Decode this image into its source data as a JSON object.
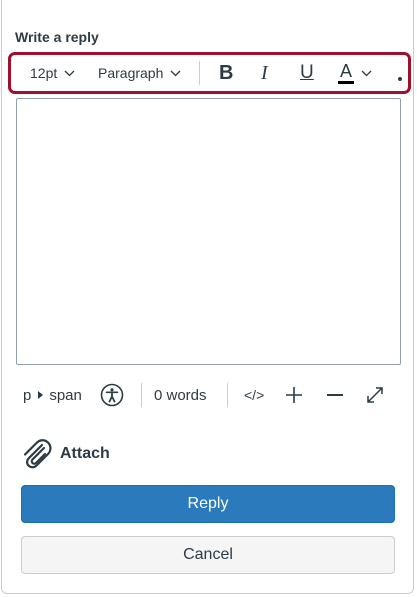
{
  "form": {
    "heading": "Write a reply"
  },
  "toolbar": {
    "font_size": "12pt",
    "block_format": "Paragraph",
    "bold_label": "B",
    "italic_label": "I",
    "underline_label": "U",
    "text_color_label": "A",
    "icons": [
      "chevron-down-icon",
      "bold-icon",
      "italic-icon",
      "underline-icon",
      "text-color-icon",
      "more-icon"
    ]
  },
  "editor": {
    "content": ""
  },
  "statusbar": {
    "path_parent": "p",
    "path_child": "span",
    "word_count": "0 words",
    "html_toggle": "</>",
    "icons": [
      "accessibility-icon",
      "plus-icon",
      "minus-icon",
      "fullscreen-icon"
    ]
  },
  "attach": {
    "label": "Attach",
    "icon": "paperclip-icon"
  },
  "actions": {
    "reply_label": "Reply",
    "cancel_label": "Cancel"
  },
  "colors": {
    "primary": "#2b7abc",
    "toolbar_highlight": "#a0102a",
    "text": "#2d3b45",
    "border": "#c7cdd1"
  }
}
